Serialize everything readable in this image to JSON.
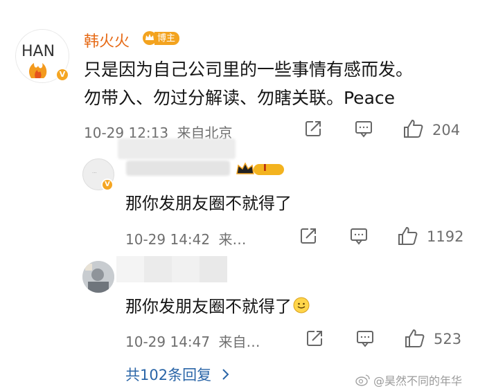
{
  "post": {
    "author_name": "韩火火",
    "author_badge": "博主",
    "avatar_text": "HAN",
    "avatar_v": "V",
    "lines": [
      "只是因为自己公司里的一些事情有感而发。",
      "勿带入、勿过分解读、勿瞎关联。Peace"
    ],
    "timestamp": "10-29 12:13",
    "location": "来自北京",
    "like_count": "204"
  },
  "replies": [
    {
      "text": "那你发朋友圈不就得了",
      "timestamp": "10-29 14:42",
      "location": "来…",
      "like_count": "1192",
      "level_badge": "I",
      "avatar_v": "V"
    },
    {
      "text": "那你发朋友圈不就得了",
      "timestamp": "10-29 14:47",
      "location": "来自…",
      "like_count": "523"
    }
  ],
  "more_replies": "共102条回复",
  "watermark": "@昊然不同的年华",
  "colors": {
    "author_name": "#e66a16",
    "badge": "#f3a31f",
    "link": "#2a65a7",
    "meta": "#6e6e6e"
  },
  "icons": [
    "share-icon",
    "comment-icon",
    "like-icon",
    "chevron-right-icon",
    "smile-emoji-icon",
    "crown-icon",
    "weibo-logo-icon"
  ]
}
